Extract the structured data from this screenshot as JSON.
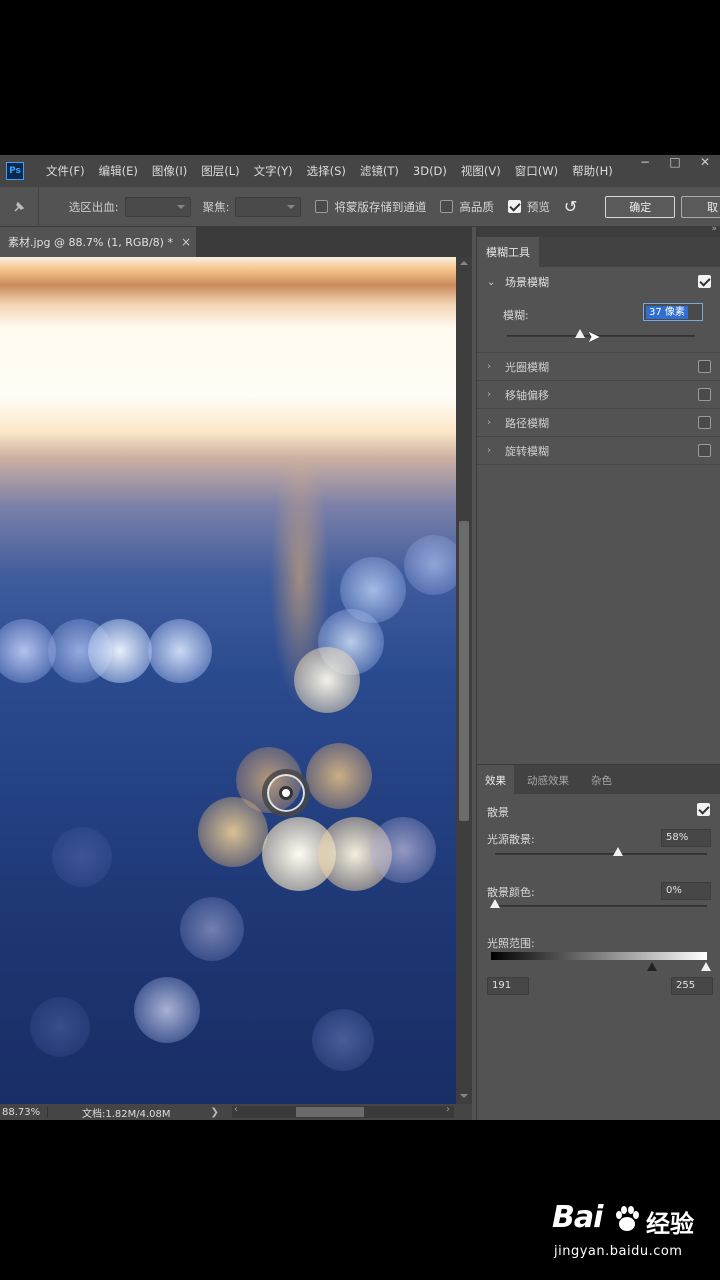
{
  "app": {
    "logo": "Ps"
  },
  "menu": [
    "文件(F)",
    "编辑(E)",
    "图像(I)",
    "图层(L)",
    "文字(Y)",
    "选择(S)",
    "滤镜(T)",
    "3D(D)",
    "视图(V)",
    "窗口(W)",
    "帮助(H)"
  ],
  "window_controls": [
    "−",
    "□",
    "✕"
  ],
  "options": {
    "tool_icon": "pin-tool-icon",
    "output_label": "选区出血:",
    "focus_label": "聚焦:",
    "save_mask_label": "将蒙版存储到通道",
    "save_mask_checked": false,
    "high_quality_label": "高品质",
    "high_quality_checked": false,
    "preview_label": "预览",
    "preview_checked": true,
    "reset_icon": "↺",
    "ok_label": "确定",
    "cancel_label": "取"
  },
  "document_tab": {
    "title": "素材.jpg @ 88.7% (1, RGB/8) *",
    "close": "×"
  },
  "status": {
    "zoom": "88.73%",
    "doc_size": "文档:1.82M/4.08M",
    "arrow": "❯",
    "left_arrow": "‹",
    "right_arrow": "›"
  },
  "blur_tools": {
    "tab_label": "模糊工具",
    "scene": {
      "label": "场景模糊",
      "checked": true,
      "blur_label": "模糊:",
      "blur_value": "37 像素",
      "blur_fraction": 0.39
    },
    "items": [
      {
        "label": "光圈模糊",
        "checked": false
      },
      {
        "label": "移轴偏移",
        "checked": false
      },
      {
        "label": "路径模糊",
        "checked": false
      },
      {
        "label": "旋转模糊",
        "checked": false
      }
    ]
  },
  "effects": {
    "tabs": [
      "效果",
      "动感效果",
      "杂色"
    ],
    "bokeh_label": "散景",
    "bokeh_checked": true,
    "light_bokeh_label": "光源散景:",
    "light_bokeh_value": "58%",
    "light_bokeh_fraction": 0.58,
    "bokeh_color_label": "散景颜色:",
    "bokeh_color_value": "0%",
    "bokeh_color_fraction": 0.0,
    "light_range_label": "光照范围:",
    "light_range_low": "191",
    "light_range_high": "255"
  },
  "watermark": {
    "brand": "Bai",
    "brand_cn": "经验",
    "url": "jingyan.baidu.com"
  }
}
